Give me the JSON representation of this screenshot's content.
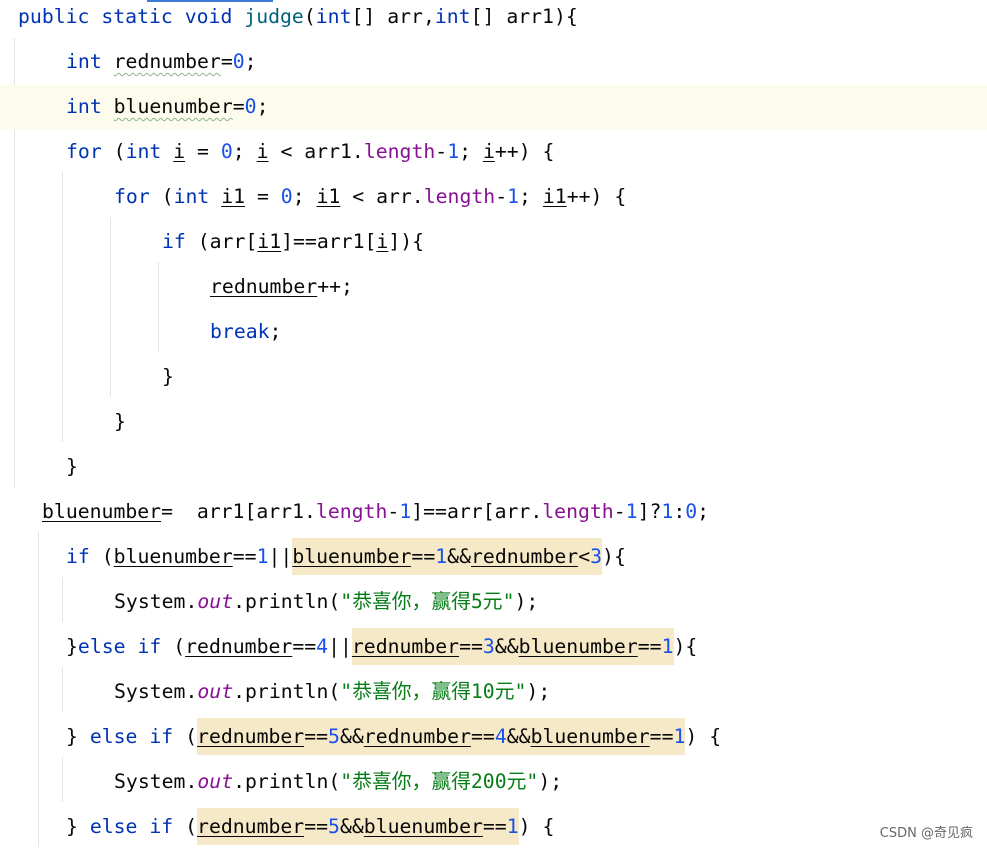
{
  "editor": {
    "lines": [
      {
        "indent": 18,
        "tokens": [
          {
            "t": "public static void ",
            "c": "kw"
          },
          {
            "t": "judge",
            "c": "fn"
          },
          {
            "t": "("
          },
          {
            "t": "int",
            "c": "kw"
          },
          {
            "t": "[] arr,"
          },
          {
            "t": "int",
            "c": "kw"
          },
          {
            "t": "[] arr1){"
          }
        ]
      },
      {
        "indent": 66,
        "tokens": [
          {
            "t": "int ",
            "c": "kw"
          },
          {
            "t": "rednumber",
            "c": "warn"
          },
          {
            "t": "="
          },
          {
            "t": "0",
            "c": "num"
          },
          {
            "t": ";"
          }
        ]
      },
      {
        "indent": 66,
        "current": true,
        "tokens": [
          {
            "t": "int ",
            "c": "kw"
          },
          {
            "t": "bluenumber",
            "c": "warn"
          },
          {
            "t": "="
          },
          {
            "t": "0",
            "c": "num"
          },
          {
            "t": ";"
          }
        ]
      },
      {
        "indent": 66,
        "tokens": [
          {
            "t": "for ",
            "c": "kw"
          },
          {
            "t": "("
          },
          {
            "t": "int ",
            "c": "kw"
          },
          {
            "t": "i",
            "c": "ul"
          },
          {
            "t": " = "
          },
          {
            "t": "0",
            "c": "num"
          },
          {
            "t": "; "
          },
          {
            "t": "i",
            "c": "ul"
          },
          {
            "t": " < arr1."
          },
          {
            "t": "length",
            "c": "fld"
          },
          {
            "t": "-"
          },
          {
            "t": "1",
            "c": "num"
          },
          {
            "t": "; "
          },
          {
            "t": "i",
            "c": "ul"
          },
          {
            "t": "++) {"
          }
        ]
      },
      {
        "indent": 114,
        "tokens": [
          {
            "t": "for ",
            "c": "kw"
          },
          {
            "t": "("
          },
          {
            "t": "int ",
            "c": "kw"
          },
          {
            "t": "i1",
            "c": "ul"
          },
          {
            "t": " = "
          },
          {
            "t": "0",
            "c": "num"
          },
          {
            "t": "; "
          },
          {
            "t": "i1",
            "c": "ul"
          },
          {
            "t": " < arr."
          },
          {
            "t": "length",
            "c": "fld"
          },
          {
            "t": "-"
          },
          {
            "t": "1",
            "c": "num"
          },
          {
            "t": "; "
          },
          {
            "t": "i1",
            "c": "ul"
          },
          {
            "t": "++) {"
          }
        ]
      },
      {
        "indent": 162,
        "tokens": [
          {
            "t": "if ",
            "c": "kw"
          },
          {
            "t": "(arr["
          },
          {
            "t": "i1",
            "c": "ul"
          },
          {
            "t": "]==arr1["
          },
          {
            "t": "i",
            "c": "ul"
          },
          {
            "t": "]){"
          }
        ]
      },
      {
        "indent": 210,
        "tokens": [
          {
            "t": "rednumber",
            "c": "ul"
          },
          {
            "t": "++;"
          }
        ]
      },
      {
        "indent": 210,
        "tokens": [
          {
            "t": "break",
            "c": "kw"
          },
          {
            "t": ";"
          }
        ]
      },
      {
        "indent": 162,
        "tokens": [
          {
            "t": "}"
          }
        ]
      },
      {
        "indent": 114,
        "tokens": [
          {
            "t": "}"
          }
        ]
      },
      {
        "indent": 66,
        "tokens": [
          {
            "t": "}"
          }
        ]
      },
      {
        "indent": 42,
        "tokens": [
          {
            "t": "bluenumber",
            "c": "ul"
          },
          {
            "t": "=  arr1[arr1."
          },
          {
            "t": "length",
            "c": "fld"
          },
          {
            "t": "-"
          },
          {
            "t": "1",
            "c": "num"
          },
          {
            "t": "]==arr[arr."
          },
          {
            "t": "length",
            "c": "fld"
          },
          {
            "t": "-"
          },
          {
            "t": "1",
            "c": "num"
          },
          {
            "t": "]?"
          },
          {
            "t": "1",
            "c": "num"
          },
          {
            "t": ":"
          },
          {
            "t": "0",
            "c": "num"
          },
          {
            "t": ";"
          }
        ]
      },
      {
        "indent": 66,
        "tokens": [
          {
            "t": "if ",
            "c": "kw"
          },
          {
            "t": "("
          },
          {
            "t": "bluenumber",
            "c": "ul"
          },
          {
            "t": "=="
          },
          {
            "t": "1",
            "c": "num"
          },
          {
            "t": "||"
          },
          {
            "t": "bluenumber",
            "c": "ul hl"
          },
          {
            "t": "==",
            "c": "hl"
          },
          {
            "t": "1",
            "c": "num hl"
          },
          {
            "t": "&&",
            "c": "hl"
          },
          {
            "t": "rednumber",
            "c": "ul hl"
          },
          {
            "t": "<",
            "c": "hl"
          },
          {
            "t": "3",
            "c": "num hl"
          },
          {
            "t": "){"
          }
        ]
      },
      {
        "indent": 114,
        "tokens": [
          {
            "t": "System."
          },
          {
            "t": "out",
            "c": "sfld"
          },
          {
            "t": ".println("
          },
          {
            "t": "\"恭喜你，赢得5元\"",
            "c": "str"
          },
          {
            "t": ");"
          }
        ]
      },
      {
        "indent": 66,
        "tokens": [
          {
            "t": "}"
          },
          {
            "t": "else if ",
            "c": "kw"
          },
          {
            "t": "("
          },
          {
            "t": "rednumber",
            "c": "ul"
          },
          {
            "t": "=="
          },
          {
            "t": "4",
            "c": "num"
          },
          {
            "t": "||"
          },
          {
            "t": "rednumber",
            "c": "ul hl"
          },
          {
            "t": "==",
            "c": "hl"
          },
          {
            "t": "3",
            "c": "num hl"
          },
          {
            "t": "&&",
            "c": "hl"
          },
          {
            "t": "bluenumber",
            "c": "ul hl"
          },
          {
            "t": "==",
            "c": "hl"
          },
          {
            "t": "1",
            "c": "num hl"
          },
          {
            "t": "){"
          }
        ]
      },
      {
        "indent": 114,
        "tokens": [
          {
            "t": "System."
          },
          {
            "t": "out",
            "c": "sfld"
          },
          {
            "t": ".println("
          },
          {
            "t": "\"恭喜你，赢得10元\"",
            "c": "str"
          },
          {
            "t": ");"
          }
        ]
      },
      {
        "indent": 66,
        "tokens": [
          {
            "t": "} "
          },
          {
            "t": "else if ",
            "c": "kw"
          },
          {
            "t": "("
          },
          {
            "t": "rednumber",
            "c": "ul hl"
          },
          {
            "t": "==",
            "c": "hl"
          },
          {
            "t": "5",
            "c": "num hl"
          },
          {
            "t": "&&",
            "c": "hl"
          },
          {
            "t": "rednumber",
            "c": "ul hl"
          },
          {
            "t": "==",
            "c": "hl"
          },
          {
            "t": "4",
            "c": "num hl"
          },
          {
            "t": "&&",
            "c": "hl"
          },
          {
            "t": "bluenumber",
            "c": "ul hl"
          },
          {
            "t": "==",
            "c": "hl"
          },
          {
            "t": "1",
            "c": "num hl"
          },
          {
            "t": ") {"
          }
        ]
      },
      {
        "indent": 114,
        "tokens": [
          {
            "t": "System."
          },
          {
            "t": "out",
            "c": "sfld"
          },
          {
            "t": ".println("
          },
          {
            "t": "\"恭喜你，赢得200元\"",
            "c": "str"
          },
          {
            "t": ");"
          }
        ]
      },
      {
        "indent": 66,
        "tokens": [
          {
            "t": "} "
          },
          {
            "t": "else if ",
            "c": "kw"
          },
          {
            "t": "("
          },
          {
            "t": "rednumber",
            "c": "ul hl"
          },
          {
            "t": "==",
            "c": "hl"
          },
          {
            "t": "5",
            "c": "num hl"
          },
          {
            "t": "&&",
            "c": "hl"
          },
          {
            "t": "bluenumber",
            "c": "ul hl"
          },
          {
            "t": "==",
            "c": "hl"
          },
          {
            "t": "1",
            "c": "num hl"
          },
          {
            "t": ") {"
          }
        ]
      }
    ]
  },
  "watermark": "CSDN @奇见疯",
  "colors": {
    "keyword": "#0033b3",
    "number": "#1750eb",
    "string": "#067d17",
    "field": "#871094",
    "method": "#00627a",
    "highlight": "#f5e9c7",
    "current_line": "#fdfbec"
  }
}
